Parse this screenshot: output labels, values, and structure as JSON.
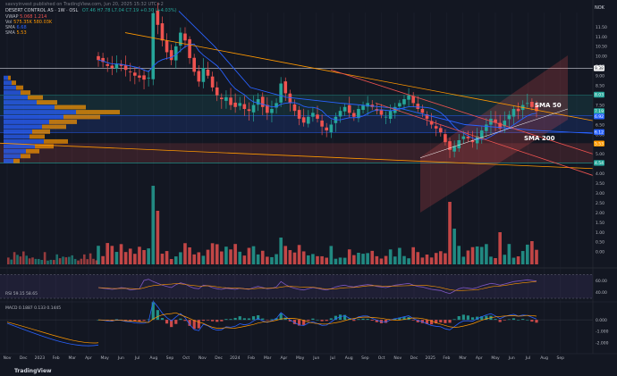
{
  "header": {
    "publisher": "savvyinvest published on TradingView.com, Jun 20, 2025 15:32 UTC+2",
    "symbol_line": "DESERT CONTROL AS · 1W · OSL",
    "ohlc": "O7.46 H7.78 L7.04 C7.19 +0.30 (+4.03%)",
    "ind_vwap": "VWAP",
    "ind_vwap_vals": "5.068  1.214",
    "ind_vol": "Vol",
    "ind_vol_vals": "575.35K  580.03K",
    "ind_sma1": "SMA",
    "ind_sma1_val": "6.68",
    "ind_sma2": "SMA",
    "ind_sma2_val": "5.53",
    "currency": "NOK"
  },
  "annotations": {
    "sma50": "SMA 50",
    "sma200": "SMA 200"
  },
  "footer": {
    "brand": "TradingView"
  },
  "colors": {
    "bg": "#131722",
    "up": "#26a69a",
    "down": "#ef5350",
    "sma50": "#2962ff",
    "sma200": "#ff9800",
    "rsi": "#7e57c2",
    "macd": "#2962ff",
    "signal": "#ff9800"
  },
  "chart_data": [
    {
      "type": "candlestick",
      "title": "DESERT CONTROL AS · 1W · OSL",
      "y_axis_side": "right",
      "ylim": [
        3.6,
        12.4
      ],
      "y_ticks": [
        "11.50",
        "11.00",
        "10.50",
        "10.00",
        "9.50",
        "9.00",
        "8.50",
        "8.00",
        "7.50",
        "7.00",
        "6.50",
        "6.00",
        "5.50",
        "5.00",
        "4.50",
        "4.00",
        "3.50",
        "3.00",
        "2.50",
        "2.00",
        "1.50",
        "1.00",
        "0.50",
        "0.00"
      ],
      "price_labels": [
        {
          "value": 9.38,
          "text": "9.38",
          "color": "#ffffff"
        },
        {
          "value": 8.03,
          "text": "8.03",
          "color": "#26a69a"
        },
        {
          "value": 7.19,
          "text": "7.19",
          "color": "#26a69a"
        },
        {
          "value": 6.92,
          "text": "6.92",
          "color": "#2962ff"
        },
        {
          "value": 6.12,
          "text": "6.12",
          "color": "#2962ff"
        },
        {
          "value": 5.53,
          "text": "5.53",
          "color": "#ff9800"
        },
        {
          "value": 4.54,
          "text": "4.54",
          "color": "#26a69a"
        }
      ],
      "x_labels": [
        "Nov",
        "Dec",
        "2023",
        "Feb",
        "Mar",
        "Apr",
        "May",
        "Jun",
        "Jul",
        "Aug",
        "Sep",
        "Oct",
        "Nov",
        "Dec",
        "2024",
        "Feb",
        "Mar",
        "Apr",
        "May",
        "Jun",
        "Jul",
        "Aug",
        "Sep",
        "Oct",
        "Nov",
        "Dec",
        "2025",
        "Feb",
        "Mar",
        "Apr",
        "May",
        "Jun",
        "Jul",
        "Aug",
        "Sep"
      ],
      "price_path_weekly": [
        9.8,
        9.7,
        9.5,
        9.4,
        9.6,
        9.5,
        9.3,
        9.2,
        9.0,
        8.9,
        8.8,
        8.9,
        12.2,
        11.6,
        10.8,
        10.2,
        9.8,
        10.5,
        11.2,
        10.8,
        9.9,
        9.2,
        8.7,
        9.4,
        9.0,
        8.4,
        8.0,
        7.8,
        7.9,
        7.5,
        7.4,
        7.6,
        7.3,
        7.2,
        7.5,
        7.8,
        7.4,
        7.1,
        7.3,
        7.6,
        8.6,
        8.1,
        7.6,
        7.2,
        6.8,
        6.6,
        6.9,
        7.1,
        6.8,
        6.4,
        6.2,
        6.5,
        6.9,
        7.2,
        7.4,
        7.1,
        6.9,
        7.3,
        7.5,
        7.6,
        7.4,
        7.2,
        7.0,
        6.9,
        7.2,
        7.4,
        7.6,
        7.8,
        8.0,
        7.6,
        7.3,
        7.1,
        6.8,
        6.5,
        6.3,
        6.1,
        5.6,
        5.2,
        5.4,
        5.7,
        5.9,
        5.8,
        5.6,
        5.9,
        6.2,
        6.5,
        6.8,
        6.6,
        6.3,
        6.7,
        7.0,
        7.3,
        7.19,
        7.5,
        7.6,
        7.4,
        7.19
      ],
      "series": [
        {
          "name": "SMA",
          "values_note": "SMA 6.68"
        },
        {
          "name": "SMA",
          "values_note": "SMA 5.53"
        }
      ]
    },
    {
      "type": "bar",
      "title": "Vol",
      "y_ticks": [
        "2.50",
        "2.00",
        "1.50",
        "1.00",
        "0.50"
      ]
    },
    {
      "type": "line",
      "title": "RSI",
      "legend": "RSI  59.15  58.65",
      "ylim": [
        30,
        75
      ],
      "y_ticks": [
        "60.00",
        "40.00"
      ],
      "values": [
        48,
        47,
        46,
        45,
        46,
        48,
        47,
        44,
        45,
        46,
        60,
        62,
        58,
        55,
        52,
        50,
        48,
        53,
        56,
        54,
        50,
        47,
        46,
        52,
        51,
        48,
        46,
        45,
        47,
        46,
        45,
        47,
        46,
        45,
        48,
        50,
        48,
        46,
        47,
        49,
        58,
        53,
        49,
        47,
        45,
        44,
        46,
        48,
        47,
        45,
        44,
        46,
        49,
        51,
        52,
        50,
        49,
        51,
        52,
        53,
        52,
        50,
        49,
        48,
        50,
        52,
        53,
        54,
        55,
        52,
        50,
        49,
        47,
        45,
        44,
        43,
        40,
        38,
        42,
        46,
        48,
        47,
        46,
        48,
        51,
        53,
        55,
        54,
        52,
        54,
        56,
        58,
        59,
        60,
        61,
        60,
        59
      ]
    },
    {
      "type": "line",
      "title": "MACD",
      "legend": "MACD  0.1887  0.133  0.1445",
      "ylim": [
        -2.8,
        1.1
      ],
      "y_ticks": [
        "0.000",
        "-1.000",
        "-2.000"
      ]
    }
  ]
}
